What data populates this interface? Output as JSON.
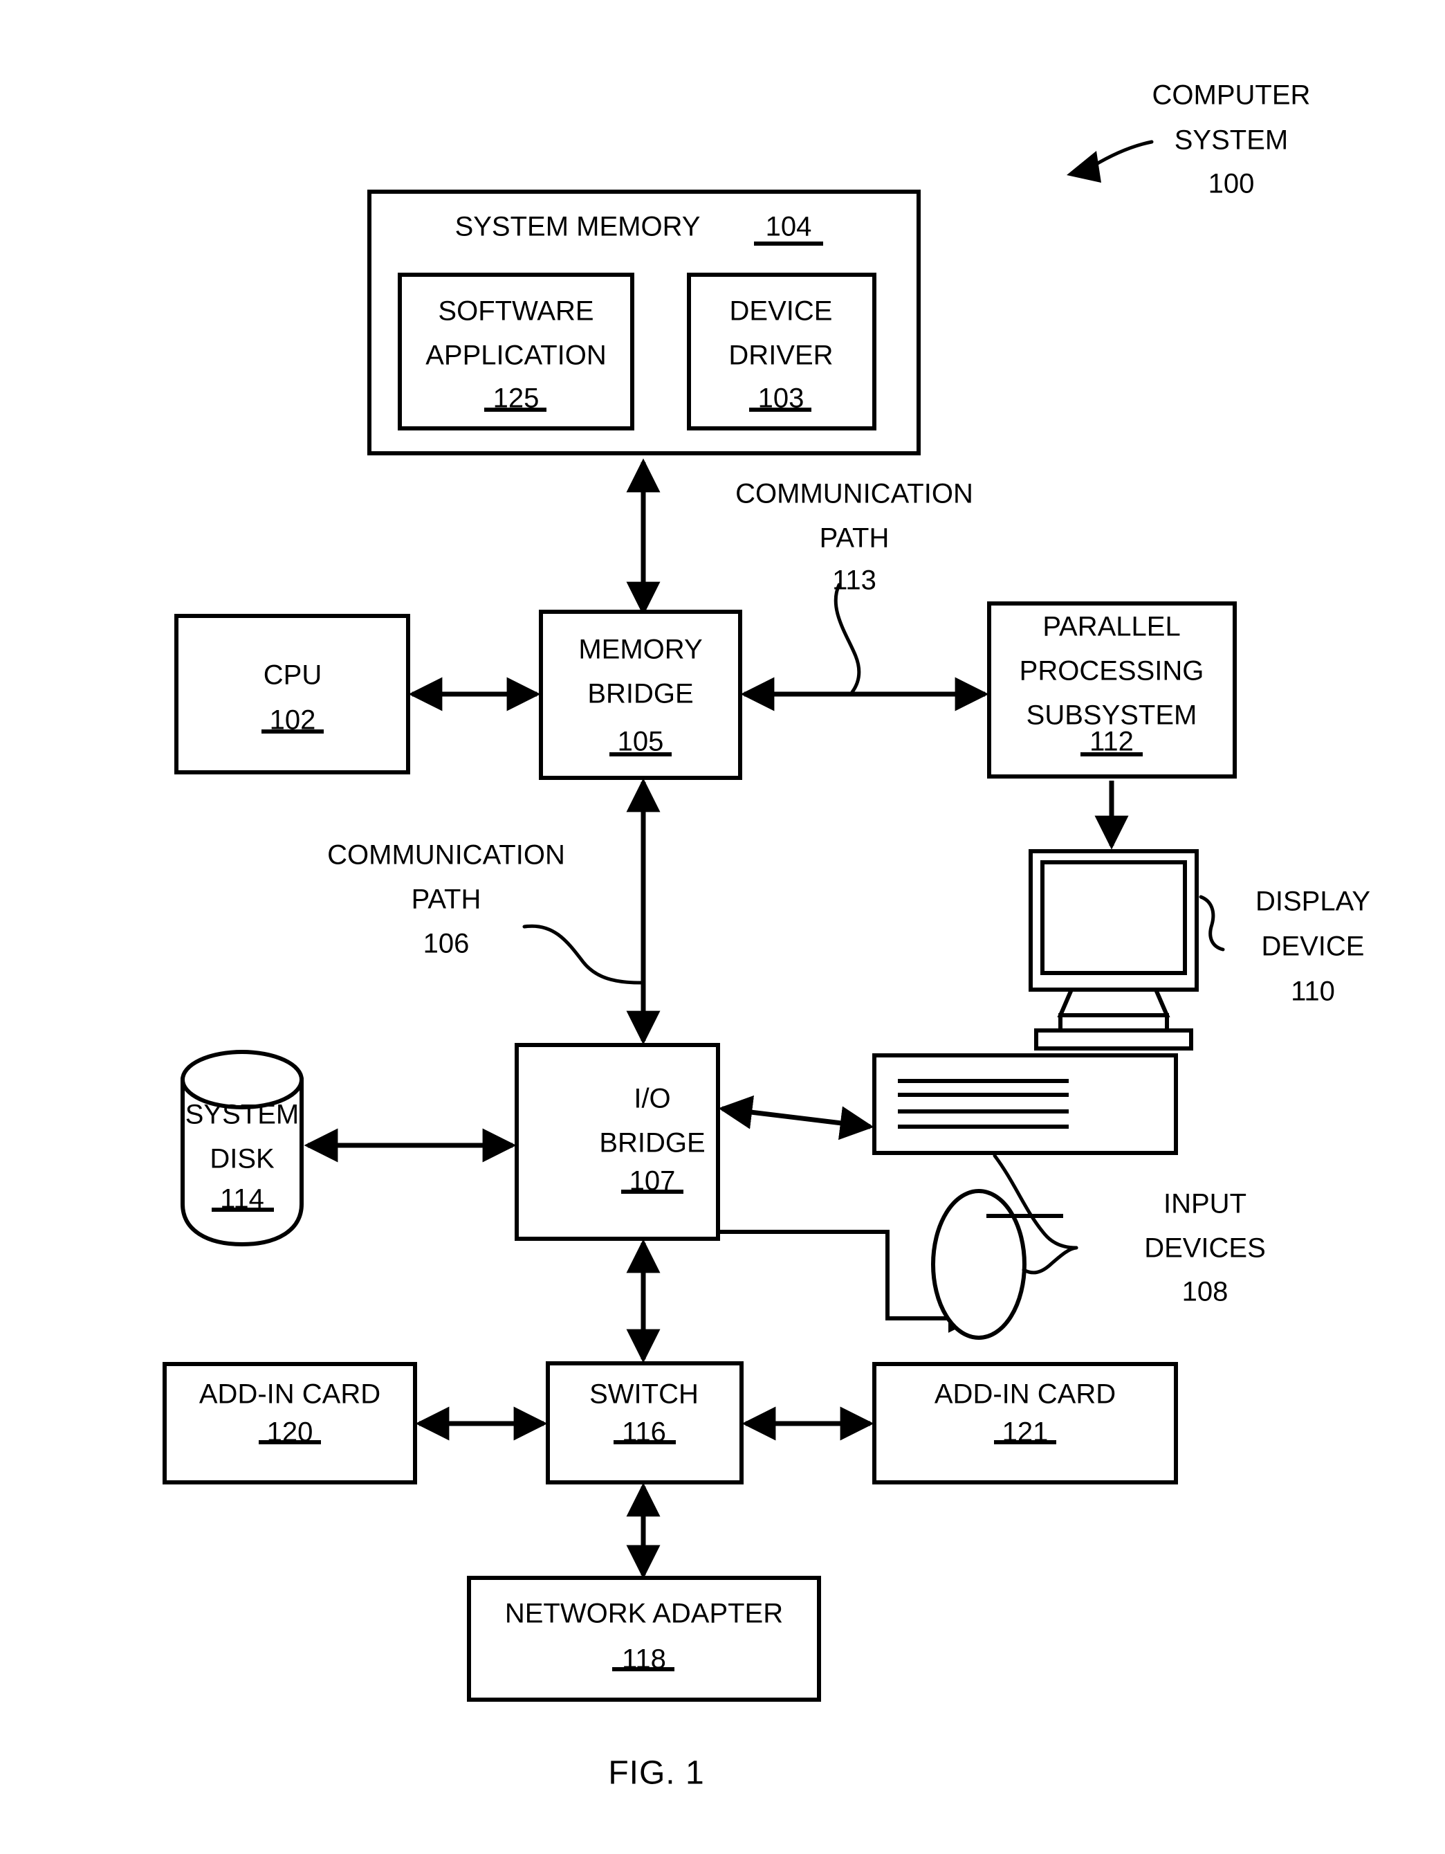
{
  "figure": {
    "caption": "FIG. 1",
    "callout": {
      "line1": "COMPUTER",
      "line2": "SYSTEM",
      "ref": "100"
    }
  },
  "blocks": {
    "system_memory": {
      "label": "SYSTEM MEMORY",
      "ref": "104"
    },
    "software_application": {
      "line1": "SOFTWARE",
      "line2": "APPLICATION",
      "ref": "125"
    },
    "device_driver": {
      "line1": "DEVICE",
      "line2": "DRIVER",
      "ref": "103"
    },
    "cpu": {
      "label": "CPU",
      "ref": "102"
    },
    "memory_bridge": {
      "line1": "MEMORY",
      "line2": "BRIDGE",
      "ref": "105"
    },
    "parallel_processing_subsystem": {
      "line1": "PARALLEL",
      "line2": "PROCESSING",
      "line3": "SUBSYSTEM",
      "ref": "112"
    },
    "display_device": {
      "line1": "DISPLAY",
      "line2": "DEVICE",
      "ref": "110"
    },
    "system_disk": {
      "line1": "SYSTEM",
      "line2": "DISK",
      "ref": "114"
    },
    "io_bridge": {
      "line1": "I/O",
      "line2": "BRIDGE",
      "ref": "107"
    },
    "input_devices": {
      "line1": "INPUT",
      "line2": "DEVICES",
      "ref": "108"
    },
    "switch": {
      "label": "SWITCH",
      "ref": "116"
    },
    "add_in_card_left": {
      "label": "ADD-IN CARD",
      "ref": "120"
    },
    "add_in_card_right": {
      "label": "ADD-IN CARD",
      "ref": "121"
    },
    "network_adapter": {
      "label": "NETWORK ADAPTER",
      "ref": "118"
    }
  },
  "paths": {
    "comm_path_113": {
      "line1": "COMMUNICATION",
      "line2": "PATH",
      "ref": "113"
    },
    "comm_path_106": {
      "line1": "COMMUNICATION",
      "line2": "PATH",
      "ref": "106"
    }
  },
  "icons": {
    "monitor": "display-monitor-icon",
    "keyboard": "keyboard-icon",
    "mouse": "mouse-icon",
    "disk_cylinder": "disk-cylinder-icon"
  },
  "style": {
    "stroke": "#000000",
    "background": "#ffffff"
  }
}
